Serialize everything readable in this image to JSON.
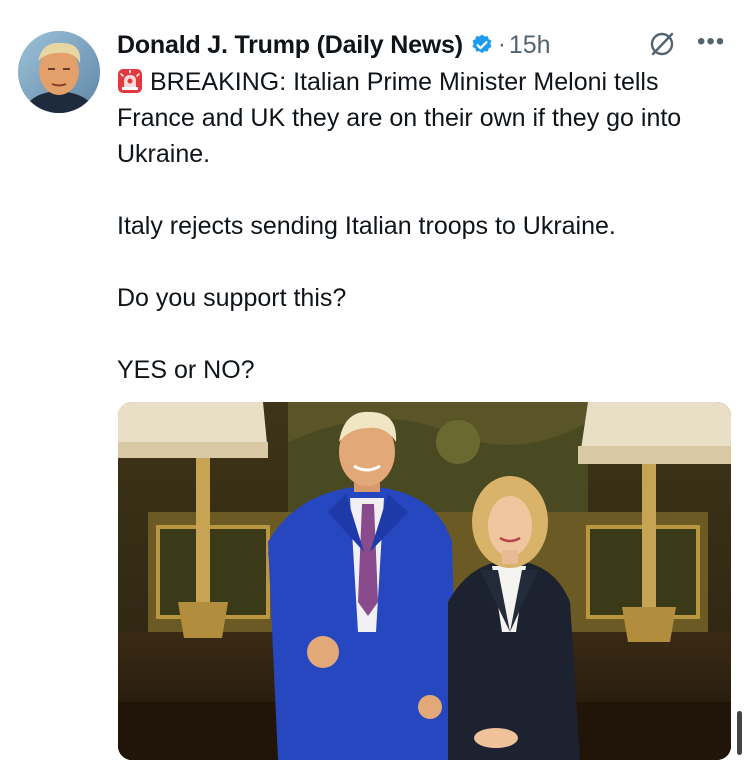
{
  "tweet": {
    "author": "Donald J. Trump (Daily News)",
    "separator": "·",
    "time": "15h",
    "more": "•••",
    "emoji_icon": "police-car-light-icon",
    "paragraphs": [
      "BREAKING: Italian Prime Minister Meloni tells France and UK they are on their own if they go into Ukraine.",
      "Italy rejects sending Italian troops to Ukraine.",
      "Do you support this?",
      "YES or NO?"
    ]
  },
  "icons": {
    "verified": "verified-badge-icon",
    "grok": "grok-icon",
    "more": "more-options-icon"
  },
  "colors": {
    "verified_blue": "#1d9bf0",
    "text": "#0f1419",
    "secondary": "#536471",
    "siren_red": "#e0393e"
  }
}
